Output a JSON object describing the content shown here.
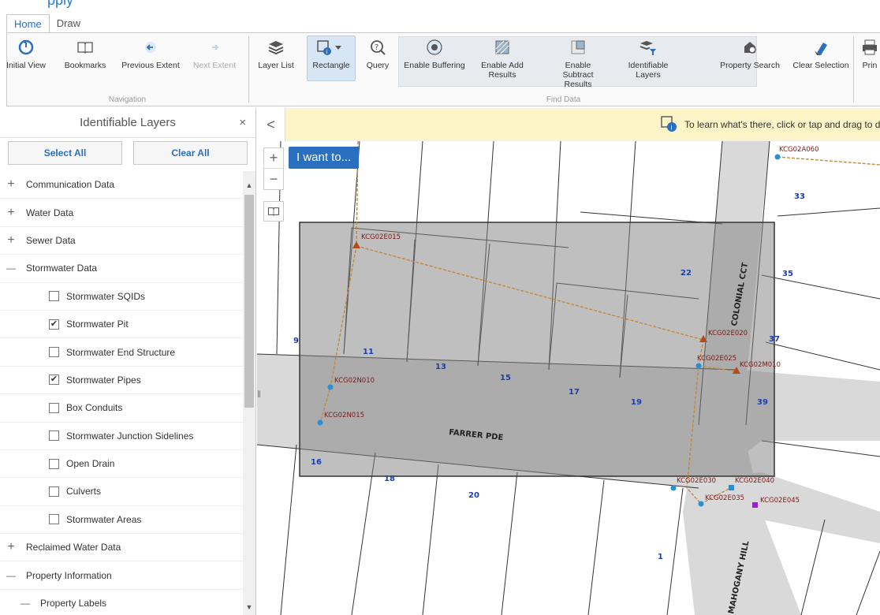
{
  "header": {
    "partial_text": "pply"
  },
  "tabs": [
    {
      "label": "Home",
      "active": true
    },
    {
      "label": "Draw",
      "active": false
    }
  ],
  "ribbon": {
    "navigation": {
      "title": "Navigation",
      "buttons": [
        {
          "label": "Initial View",
          "icon": "initial-view-icon"
        },
        {
          "label": "Bookmarks",
          "icon": "bookmarks-icon"
        },
        {
          "label": "Previous Extent",
          "icon": "previous-extent-icon"
        },
        {
          "label": "Next Extent",
          "icon": "next-extent-icon",
          "disabled": true
        }
      ]
    },
    "find_data": {
      "title": "Find Data",
      "buttons": [
        {
          "label": "Layer List",
          "icon": "layer-list-icon"
        },
        {
          "label": "Rectangle",
          "icon": "rectangle-identify-icon"
        },
        {
          "label": "Query",
          "icon": "query-icon"
        },
        {
          "label": "Enable Buffering",
          "icon": "buffer-icon"
        },
        {
          "label": "Enable Add Results",
          "icon": "add-results-icon"
        },
        {
          "label": "Enable Subtract Results",
          "icon": "subtract-results-icon"
        },
        {
          "label": "Identifiable Layers",
          "icon": "identifiable-layers-icon"
        },
        {
          "label": "Property Search",
          "icon": "property-search-icon"
        },
        {
          "label": "Clear Selection",
          "icon": "eraser-icon"
        },
        {
          "label": "Prin",
          "icon": "print-icon"
        }
      ]
    }
  },
  "panel": {
    "title": "Identifiable Layers",
    "close": "×",
    "select_all": "Select All",
    "clear_all": "Clear All",
    "layers": [
      {
        "label": "Communication Data",
        "type": "group",
        "expanded": false
      },
      {
        "label": "Water Data",
        "type": "group",
        "expanded": false
      },
      {
        "label": "Sewer Data",
        "type": "group",
        "expanded": false
      },
      {
        "label": "Stormwater Data",
        "type": "group",
        "expanded": true
      },
      {
        "label": "Stormwater SQIDs",
        "type": "check",
        "checked": false
      },
      {
        "label": "Stormwater Pit",
        "type": "check",
        "checked": true
      },
      {
        "label": "Stormwater End Structure",
        "type": "check",
        "checked": false
      },
      {
        "label": "Stormwater Pipes",
        "type": "check",
        "checked": true
      },
      {
        "label": "Box Conduits",
        "type": "check",
        "checked": false
      },
      {
        "label": "Stormwater Junction Sidelines",
        "type": "check",
        "checked": false
      },
      {
        "label": "Open Drain",
        "type": "check",
        "checked": false
      },
      {
        "label": "Culverts",
        "type": "check",
        "checked": false
      },
      {
        "label": "Stormwater Areas",
        "type": "check",
        "checked": false
      },
      {
        "label": "Reclaimed Water Data",
        "type": "group",
        "expanded": false
      },
      {
        "label": "Property Information",
        "type": "group",
        "expanded": true
      },
      {
        "label": "Property Labels",
        "type": "subgroup",
        "expanded": true
      }
    ]
  },
  "map": {
    "info_text": "To learn what's there, click or tap and drag to d",
    "i_want_to": "I want to...",
    "collapse": "<",
    "zoom_in": "+",
    "zoom_out": "−",
    "streets": [
      "FARRER PDE",
      "COLONIAL CCT",
      "MAHOGANY HILL"
    ],
    "lot_numbers": [
      "33",
      "22",
      "35",
      "37",
      "9",
      "11",
      "13",
      "15",
      "17",
      "19",
      "39",
      "16",
      "18",
      "20",
      "1"
    ],
    "asset_labels": [
      "KCG02A060",
      "KCG02E015",
      "KCG02E020",
      "KCG02E025",
      "KCG02M010",
      "KCG02N010",
      "KCG02N015",
      "KCG02E030",
      "KCG02E040",
      "KCG02E035",
      "KCG02E045"
    ]
  },
  "colors": {
    "accent": "#2a6fc0",
    "infobar": "#fdf4c8",
    "pipe": "#c08a3a",
    "pit_marker": "#b34a1a",
    "node": "#2a8fd4"
  }
}
